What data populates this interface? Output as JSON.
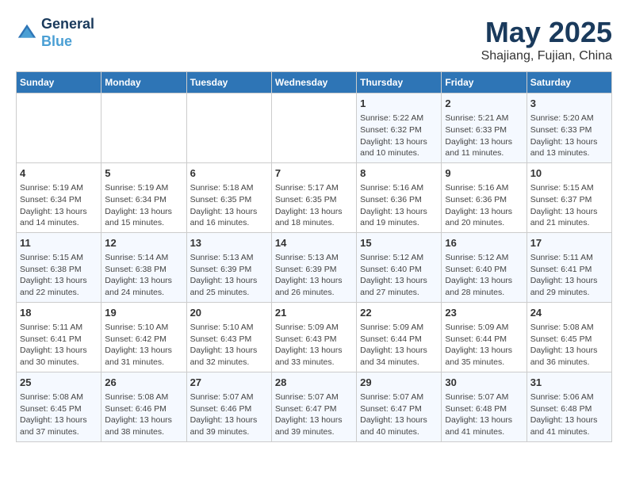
{
  "logo": {
    "line1": "General",
    "line2": "Blue"
  },
  "title": "May 2025",
  "subtitle": "Shajiang, Fujian, China",
  "days_of_week": [
    "Sunday",
    "Monday",
    "Tuesday",
    "Wednesday",
    "Thursday",
    "Friday",
    "Saturday"
  ],
  "weeks": [
    [
      {
        "day": "",
        "content": ""
      },
      {
        "day": "",
        "content": ""
      },
      {
        "day": "",
        "content": ""
      },
      {
        "day": "",
        "content": ""
      },
      {
        "day": "1",
        "content": "Sunrise: 5:22 AM\nSunset: 6:32 PM\nDaylight: 13 hours\nand 10 minutes."
      },
      {
        "day": "2",
        "content": "Sunrise: 5:21 AM\nSunset: 6:33 PM\nDaylight: 13 hours\nand 11 minutes."
      },
      {
        "day": "3",
        "content": "Sunrise: 5:20 AM\nSunset: 6:33 PM\nDaylight: 13 hours\nand 13 minutes."
      }
    ],
    [
      {
        "day": "4",
        "content": "Sunrise: 5:19 AM\nSunset: 6:34 PM\nDaylight: 13 hours\nand 14 minutes."
      },
      {
        "day": "5",
        "content": "Sunrise: 5:19 AM\nSunset: 6:34 PM\nDaylight: 13 hours\nand 15 minutes."
      },
      {
        "day": "6",
        "content": "Sunrise: 5:18 AM\nSunset: 6:35 PM\nDaylight: 13 hours\nand 16 minutes."
      },
      {
        "day": "7",
        "content": "Sunrise: 5:17 AM\nSunset: 6:35 PM\nDaylight: 13 hours\nand 18 minutes."
      },
      {
        "day": "8",
        "content": "Sunrise: 5:16 AM\nSunset: 6:36 PM\nDaylight: 13 hours\nand 19 minutes."
      },
      {
        "day": "9",
        "content": "Sunrise: 5:16 AM\nSunset: 6:36 PM\nDaylight: 13 hours\nand 20 minutes."
      },
      {
        "day": "10",
        "content": "Sunrise: 5:15 AM\nSunset: 6:37 PM\nDaylight: 13 hours\nand 21 minutes."
      }
    ],
    [
      {
        "day": "11",
        "content": "Sunrise: 5:15 AM\nSunset: 6:38 PM\nDaylight: 13 hours\nand 22 minutes."
      },
      {
        "day": "12",
        "content": "Sunrise: 5:14 AM\nSunset: 6:38 PM\nDaylight: 13 hours\nand 24 minutes."
      },
      {
        "day": "13",
        "content": "Sunrise: 5:13 AM\nSunset: 6:39 PM\nDaylight: 13 hours\nand 25 minutes."
      },
      {
        "day": "14",
        "content": "Sunrise: 5:13 AM\nSunset: 6:39 PM\nDaylight: 13 hours\nand 26 minutes."
      },
      {
        "day": "15",
        "content": "Sunrise: 5:12 AM\nSunset: 6:40 PM\nDaylight: 13 hours\nand 27 minutes."
      },
      {
        "day": "16",
        "content": "Sunrise: 5:12 AM\nSunset: 6:40 PM\nDaylight: 13 hours\nand 28 minutes."
      },
      {
        "day": "17",
        "content": "Sunrise: 5:11 AM\nSunset: 6:41 PM\nDaylight: 13 hours\nand 29 minutes."
      }
    ],
    [
      {
        "day": "18",
        "content": "Sunrise: 5:11 AM\nSunset: 6:41 PM\nDaylight: 13 hours\nand 30 minutes."
      },
      {
        "day": "19",
        "content": "Sunrise: 5:10 AM\nSunset: 6:42 PM\nDaylight: 13 hours\nand 31 minutes."
      },
      {
        "day": "20",
        "content": "Sunrise: 5:10 AM\nSunset: 6:43 PM\nDaylight: 13 hours\nand 32 minutes."
      },
      {
        "day": "21",
        "content": "Sunrise: 5:09 AM\nSunset: 6:43 PM\nDaylight: 13 hours\nand 33 minutes."
      },
      {
        "day": "22",
        "content": "Sunrise: 5:09 AM\nSunset: 6:44 PM\nDaylight: 13 hours\nand 34 minutes."
      },
      {
        "day": "23",
        "content": "Sunrise: 5:09 AM\nSunset: 6:44 PM\nDaylight: 13 hours\nand 35 minutes."
      },
      {
        "day": "24",
        "content": "Sunrise: 5:08 AM\nSunset: 6:45 PM\nDaylight: 13 hours\nand 36 minutes."
      }
    ],
    [
      {
        "day": "25",
        "content": "Sunrise: 5:08 AM\nSunset: 6:45 PM\nDaylight: 13 hours\nand 37 minutes."
      },
      {
        "day": "26",
        "content": "Sunrise: 5:08 AM\nSunset: 6:46 PM\nDaylight: 13 hours\nand 38 minutes."
      },
      {
        "day": "27",
        "content": "Sunrise: 5:07 AM\nSunset: 6:46 PM\nDaylight: 13 hours\nand 39 minutes."
      },
      {
        "day": "28",
        "content": "Sunrise: 5:07 AM\nSunset: 6:47 PM\nDaylight: 13 hours\nand 39 minutes."
      },
      {
        "day": "29",
        "content": "Sunrise: 5:07 AM\nSunset: 6:47 PM\nDaylight: 13 hours\nand 40 minutes."
      },
      {
        "day": "30",
        "content": "Sunrise: 5:07 AM\nSunset: 6:48 PM\nDaylight: 13 hours\nand 41 minutes."
      },
      {
        "day": "31",
        "content": "Sunrise: 5:06 AM\nSunset: 6:48 PM\nDaylight: 13 hours\nand 41 minutes."
      }
    ]
  ]
}
